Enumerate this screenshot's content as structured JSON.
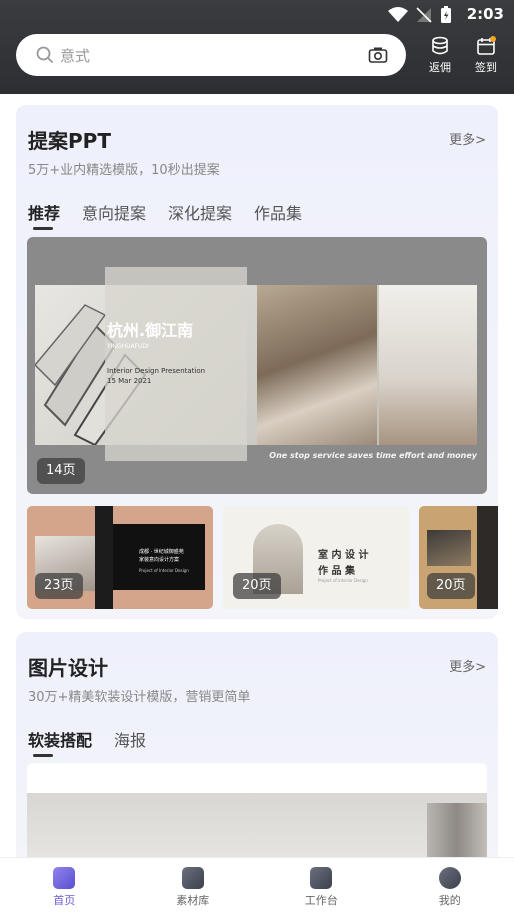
{
  "status_bar": {
    "time": "2:03"
  },
  "search": {
    "placeholder": "意式"
  },
  "top_actions": [
    {
      "label": "返佣",
      "icon": "database-icon"
    },
    {
      "label": "签到",
      "icon": "calendar-icon"
    }
  ],
  "ppt_section": {
    "title": "提案PPT",
    "more": "更多>",
    "subtitle": "5万+业内精选模版，10秒出提案",
    "tabs": [
      "推荐",
      "意向提案",
      "深化提案",
      "作品集"
    ],
    "feature": {
      "heading": "杭州.御江南",
      "brand": "YINGHUAFUDI",
      "line1": "Interior Design Presentation",
      "line2": "15 Mar 2021",
      "tagline": "One stop service saves time effort and money",
      "pages": "14页"
    },
    "thumbs": [
      {
        "pages": "23页",
        "caption1": "成都 · 世纪城御盛苑",
        "caption2": "家装意向设计方案",
        "caption3": "Project of Interior Design"
      },
      {
        "pages": "20页",
        "caption1": "室 内 设 计",
        "caption2": "作 品 集",
        "caption3": "Project of Interior Design"
      },
      {
        "pages": "20页"
      }
    ]
  },
  "image_section": {
    "title": "图片设计",
    "more": "更多>",
    "subtitle": "30万+精美软装设计模版，营销更简单",
    "tabs": [
      "软装搭配",
      "海报"
    ]
  },
  "bottom_nav": [
    {
      "label": "首页",
      "active": true
    },
    {
      "label": "素材库",
      "active": false
    },
    {
      "label": "工作台",
      "active": false
    },
    {
      "label": "我的",
      "active": false
    }
  ],
  "colors": {
    "accent": "#6b5fd6",
    "header_bg": "#2f3134",
    "card_bg": "#eef0fb"
  }
}
